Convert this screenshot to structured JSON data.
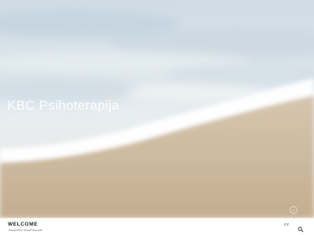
{
  "hero": {
    "title": "KBC Psihoterapija",
    "tagline": "··· · ··· ···",
    "scroll_icon": "chevron-down-icon"
  },
  "header": {
    "site_name": "WELCOME",
    "site_description": "Just another WordPress site",
    "lang_label": "CY",
    "search_icon": "search-icon"
  },
  "colors": {
    "sky": "#cfdce4",
    "sand": "#cbb79a",
    "foam": "#ffffff",
    "bar": "#ffffff"
  }
}
